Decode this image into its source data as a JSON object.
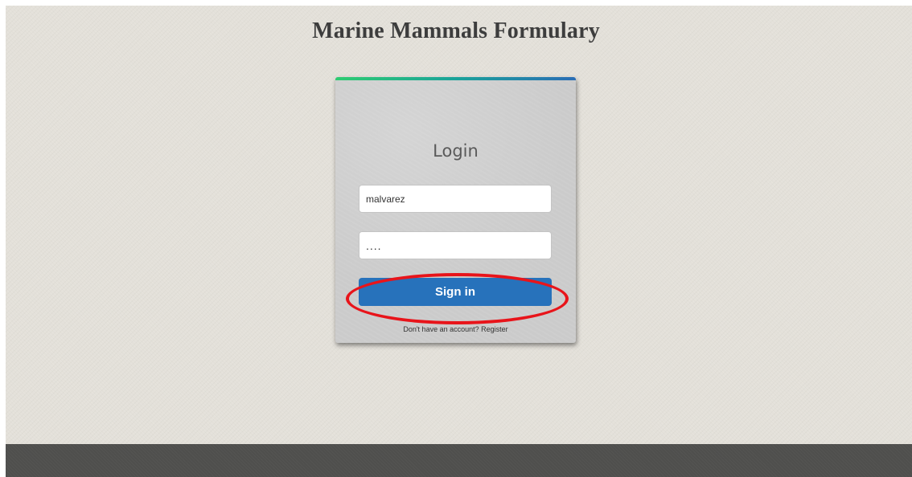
{
  "header": {
    "site_title": "Marine Mammals Formulary"
  },
  "login": {
    "heading": "Login",
    "username_value": "malvarez",
    "password_value": "....",
    "sign_in_label": "Sign in",
    "register_prompt": "Don't have an account?",
    "register_link": "Register"
  },
  "colors": {
    "accent_start": "#2ecc71",
    "accent_end": "#2a6db5",
    "button": "#2772bb",
    "highlight": "#e8141a"
  }
}
